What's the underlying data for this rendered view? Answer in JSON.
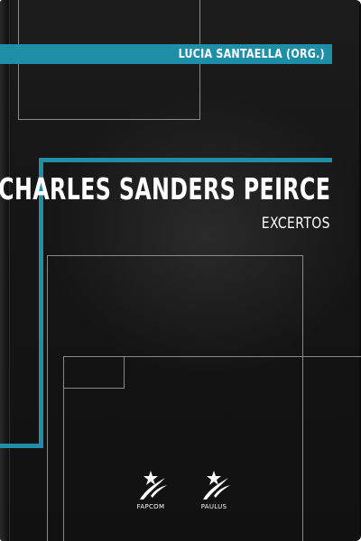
{
  "cover": {
    "author": "LUCIA SANTAELLA (ORG.)",
    "title": "CHARLES SANDERS PEIRCE",
    "subtitle": "EXCERTOS",
    "accent_color": "#1f8fa8",
    "background_color": "#151515"
  },
  "publishers": [
    {
      "label": "FAPCOM",
      "icon": "paulus-star-logo-icon"
    },
    {
      "label": "PAULUS",
      "icon": "paulus-star-logo-icon"
    }
  ]
}
